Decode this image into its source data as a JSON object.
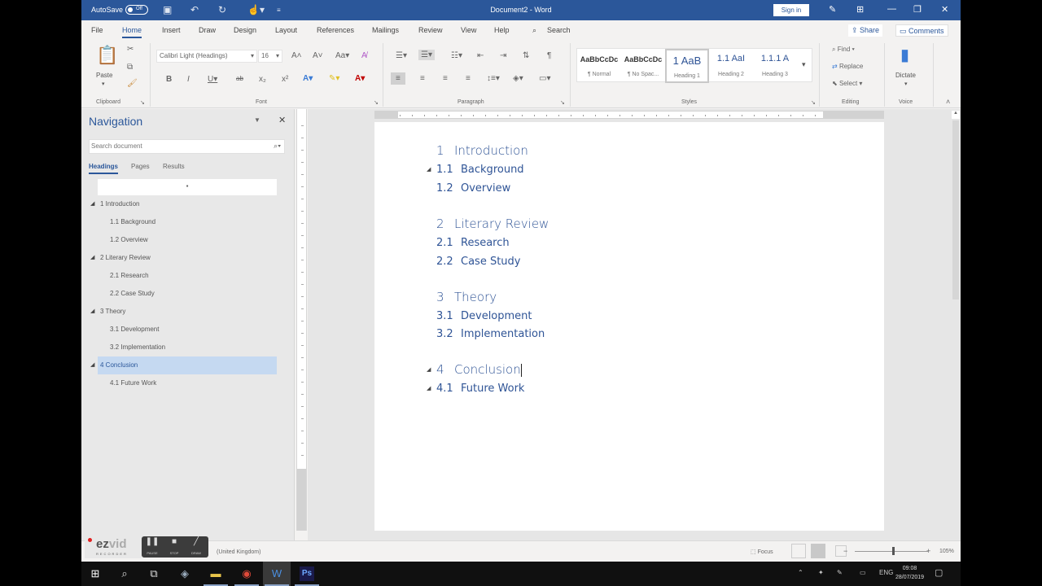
{
  "titlebar": {
    "autosave_label": "AutoSave",
    "autosave_state": "Off",
    "doc_title": "Document2 - Word",
    "signin_label": "Sign in",
    "quick_access": [
      "save-icon",
      "undo-icon",
      "redo-icon",
      "touch-mode-icon",
      "customize-icon"
    ],
    "window_controls": [
      "ribbon-display-icon",
      "minimize-icon",
      "restore-icon",
      "close-icon"
    ]
  },
  "ribbon_tabs": [
    "File",
    "Home",
    "Insert",
    "Draw",
    "Design",
    "Layout",
    "References",
    "Mailings",
    "Review",
    "View",
    "Help"
  ],
  "active_tab": "Home",
  "search_label": "Search",
  "share_label": "Share",
  "comments_label": "Comments",
  "ribbon": {
    "clipboard": {
      "paste_label": "Paste",
      "group_label": "Clipboard"
    },
    "font": {
      "font_name": "Calibri Light (Headings)",
      "font_size": "16",
      "group_label": "Font"
    },
    "paragraph": {
      "group_label": "Paragraph"
    },
    "styles": {
      "group_label": "Styles",
      "items": [
        {
          "sample": "AaBbCcDc",
          "name": "¶ Normal"
        },
        {
          "sample": "AaBbCcDc",
          "name": "¶ No Spac..."
        },
        {
          "sample": "1 AaB",
          "name": "Heading 1"
        },
        {
          "sample": "1.1 AaI",
          "name": "Heading 2"
        },
        {
          "sample": "1.1.1 A",
          "name": "Heading 3"
        }
      ],
      "selected": "Heading 1"
    },
    "editing": {
      "find": "Find",
      "replace": "Replace",
      "select": "Select",
      "group_label": "Editing"
    },
    "voice": {
      "dictate": "Dictate",
      "group_label": "Voice"
    }
  },
  "navigation": {
    "title": "Navigation",
    "search_placeholder": "Search document",
    "tabs": [
      "Headings",
      "Pages",
      "Results"
    ],
    "active_tab": "Headings",
    "items": [
      {
        "label": "1 Introduction",
        "level": 1
      },
      {
        "label": "1.1 Background",
        "level": 2
      },
      {
        "label": "1.2 Overview",
        "level": 2
      },
      {
        "label": "2 Literary Review",
        "level": 1
      },
      {
        "label": "2.1 Research",
        "level": 2
      },
      {
        "label": "2.2 Case Study",
        "level": 2
      },
      {
        "label": "3 Theory",
        "level": 1
      },
      {
        "label": "3.1 Development",
        "level": 2
      },
      {
        "label": "3.2 Implementation",
        "level": 2
      },
      {
        "label": "4 Conclusion",
        "level": 1,
        "selected": true
      },
      {
        "label": "4.1 Future Work",
        "level": 2
      }
    ]
  },
  "document": {
    "headings": [
      {
        "num": "1",
        "text": "Introduction",
        "level": 1
      },
      {
        "num": "1.1",
        "text": "Background",
        "level": 2
      },
      {
        "num": "1.2",
        "text": "Overview",
        "level": 2
      },
      {
        "num": "2",
        "text": "Literary Review",
        "level": 1
      },
      {
        "num": "2.1",
        "text": "Research",
        "level": 2
      },
      {
        "num": "2.2",
        "text": "Case Study",
        "level": 2
      },
      {
        "num": "3",
        "text": "Theory",
        "level": 1
      },
      {
        "num": "3.1",
        "text": "Development",
        "level": 2
      },
      {
        "num": "3.2",
        "text": "Implementation",
        "level": 2
      },
      {
        "num": "4",
        "text": "Conclusion",
        "level": 1
      },
      {
        "num": "4.1",
        "text": "Future Work",
        "level": 2
      }
    ],
    "heading_color": "#2f5496"
  },
  "statusbar": {
    "language": "(United Kingdom)",
    "focus_label": "Focus",
    "zoom_percent": "105%"
  },
  "ezvid": {
    "logo": "ezvid",
    "sub": "RECORDER",
    "controls": [
      "PAUSE",
      "STOP",
      "DRAW"
    ]
  },
  "taskbar": {
    "apps": [
      "start-icon",
      "search-icon",
      "task-view-icon",
      "network-app-icon",
      "file-explorer-icon",
      "chrome-icon",
      "word-icon",
      "photoshop-icon"
    ],
    "language": "ENG",
    "time": "09:08",
    "date": "28/07/2019"
  },
  "colors": {
    "word_blue": "#2b579a",
    "nav_selected": "#c5d9f1"
  }
}
